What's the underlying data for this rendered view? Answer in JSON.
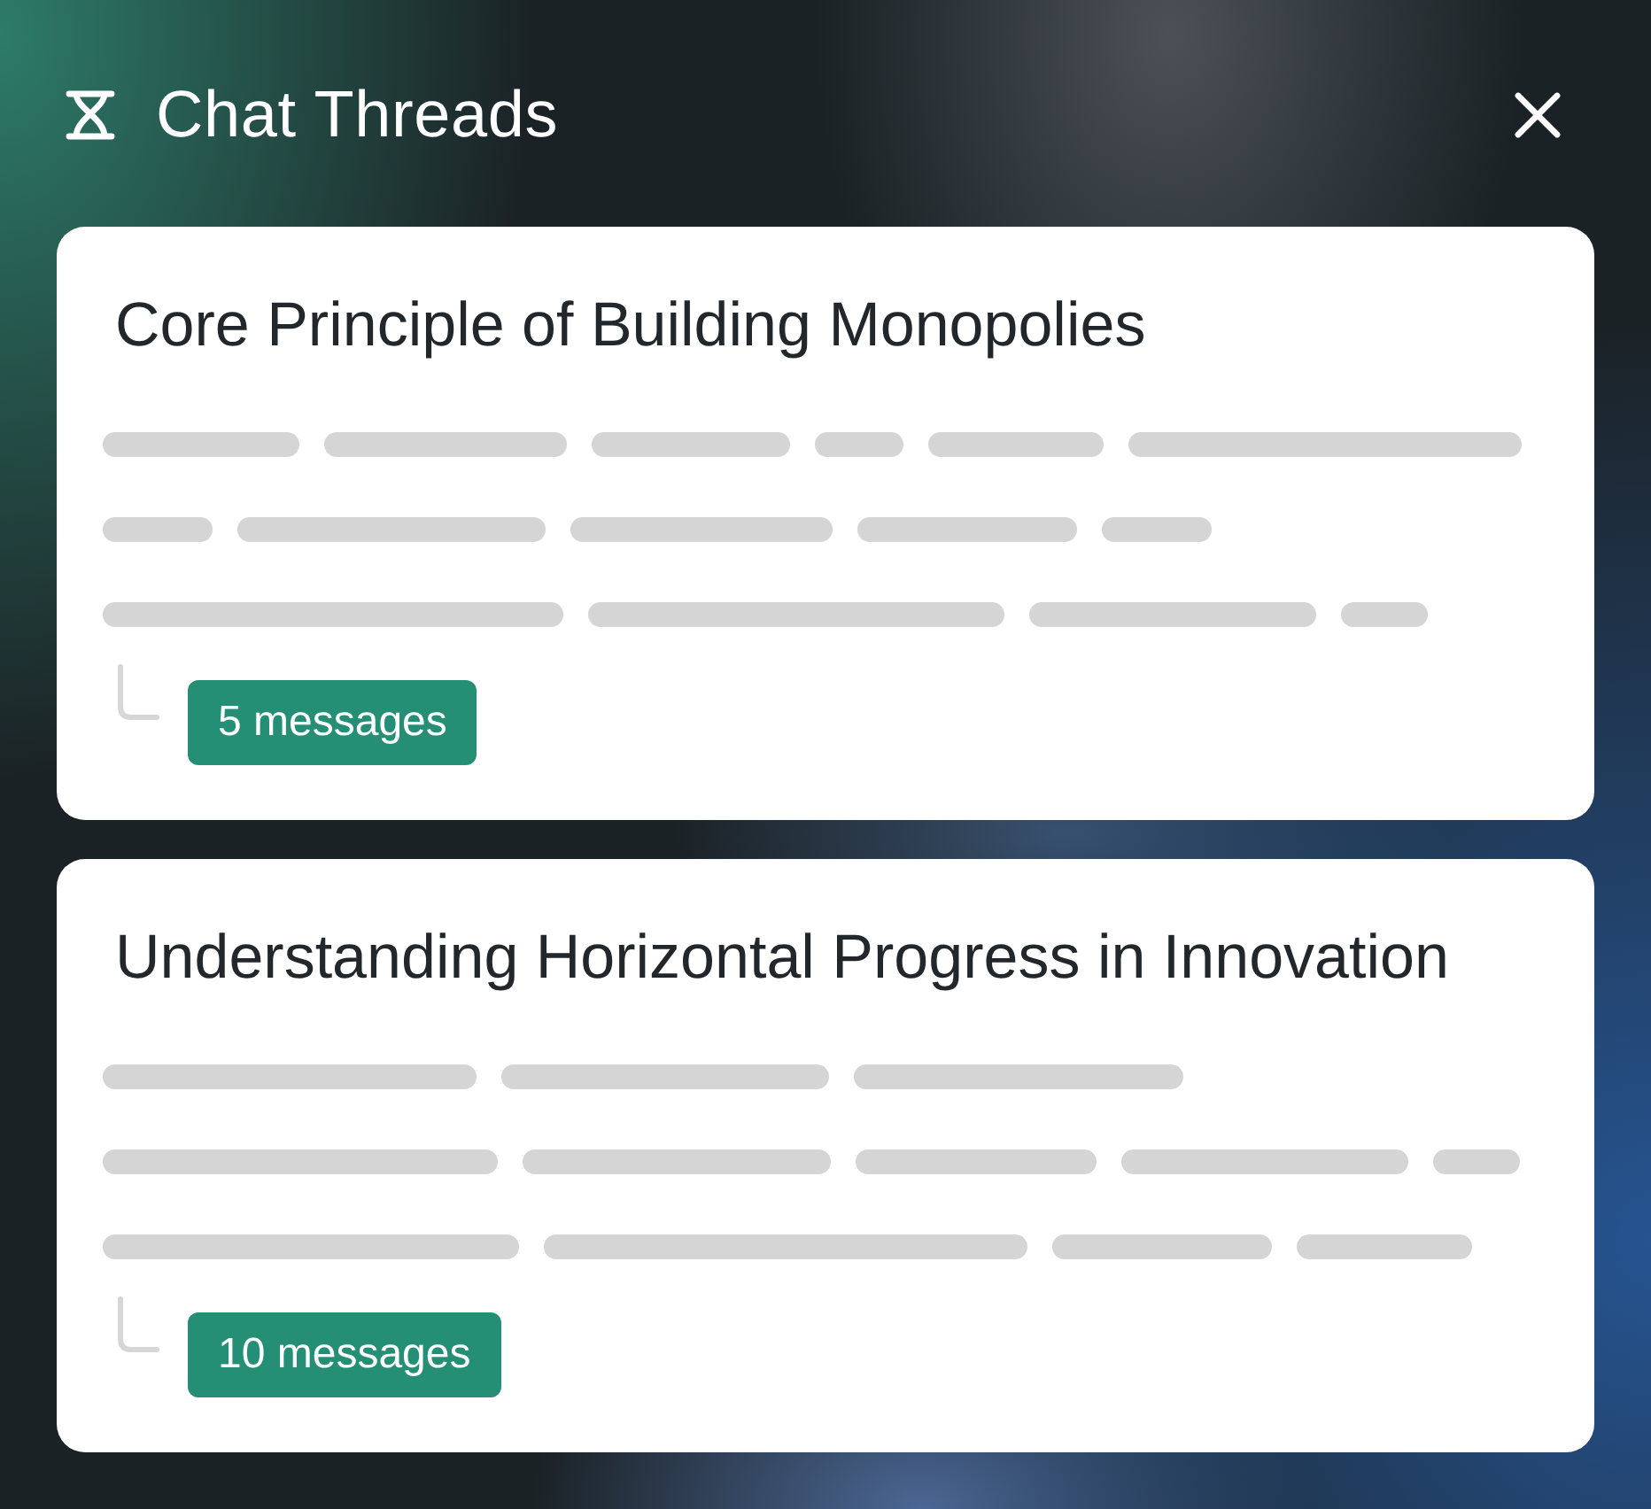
{
  "panel": {
    "title": "Chat Threads"
  },
  "threads": [
    {
      "title": "Core Principle of Building Monopolies",
      "message_count": "5 messages"
    },
    {
      "title": "Understanding Horizontal Progress in Innovation",
      "message_count": "10 messages"
    }
  ]
}
